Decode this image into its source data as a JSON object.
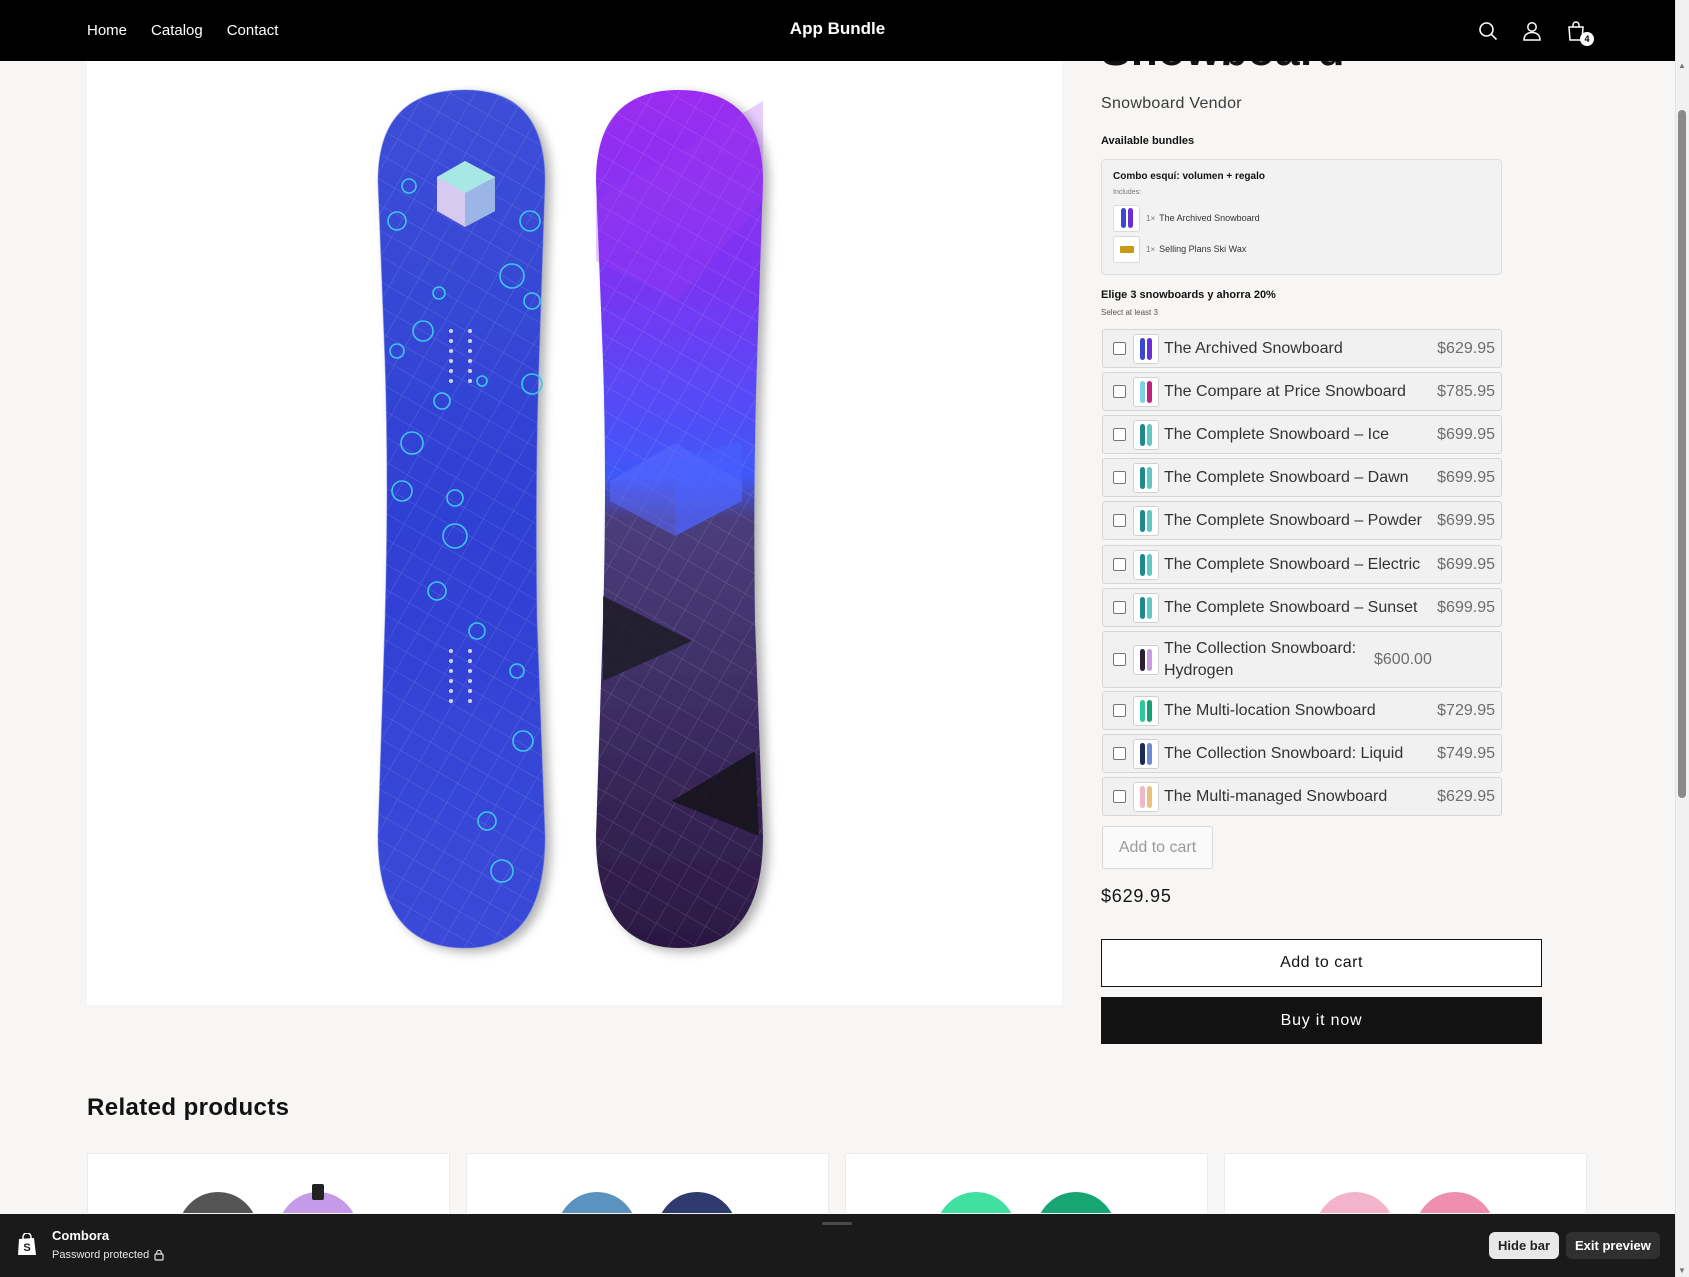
{
  "header": {
    "nav": [
      "Home",
      "Catalog",
      "Contact"
    ],
    "brand": "App Bundle",
    "icons": [
      "search-icon",
      "account-icon",
      "cart-icon"
    ],
    "cart_count": "4"
  },
  "product": {
    "title_partial": "Snowboard",
    "vendor": "Snowboard Vendor",
    "price": "$629.95",
    "add_to_cart": "Add to cart",
    "buy_now": "Buy it now"
  },
  "bundles": {
    "heading": "Available bundles",
    "combo": {
      "title": "Combo esquí: volumen + regalo",
      "includes_label": "Includes:",
      "items": [
        {
          "qty": "1×",
          "name": "The Archived Snowboard"
        },
        {
          "qty": "1×",
          "name": "Selling Plans Ski Wax"
        }
      ]
    },
    "choose": {
      "title": "Elige 3 snowboards y ahorra 20%",
      "subtitle": "Select at least 3",
      "options": [
        {
          "name": "The Archived Snowboard",
          "price": "$629.95"
        },
        {
          "name": "The Compare at Price Snowboard",
          "price": "$785.95"
        },
        {
          "name": "The Complete Snowboard – Ice",
          "price": "$699.95"
        },
        {
          "name": "The Complete Snowboard – Dawn",
          "price": "$699.95"
        },
        {
          "name": "The Complete Snowboard – Powder",
          "price": "$699.95"
        },
        {
          "name": "The Complete Snowboard – Electric",
          "price": "$699.95"
        },
        {
          "name": "The Complete Snowboard – Sunset",
          "price": "$699.95"
        },
        {
          "name": "The Collection Snowboard: Hydrogen",
          "price": "$600.00"
        },
        {
          "name": "The Multi-location Snowboard",
          "price": "$729.95"
        },
        {
          "name": "The Collection Snowboard: Liquid",
          "price": "$749.95"
        },
        {
          "name": "The Multi-managed Snowboard",
          "price": "$629.95"
        }
      ],
      "add_to_cart": "Add to cart"
    }
  },
  "related": {
    "heading": "Related products"
  },
  "preview_bar": {
    "store_name": "Combora",
    "status": "Password protected",
    "hide_bar": "Hide bar",
    "exit_preview": "Exit preview"
  },
  "colors": {
    "header_bg": "#000000",
    "page_bg": "#f7f6f4",
    "buy_button": "#121212",
    "preview_bar": "#1a1a1a"
  }
}
